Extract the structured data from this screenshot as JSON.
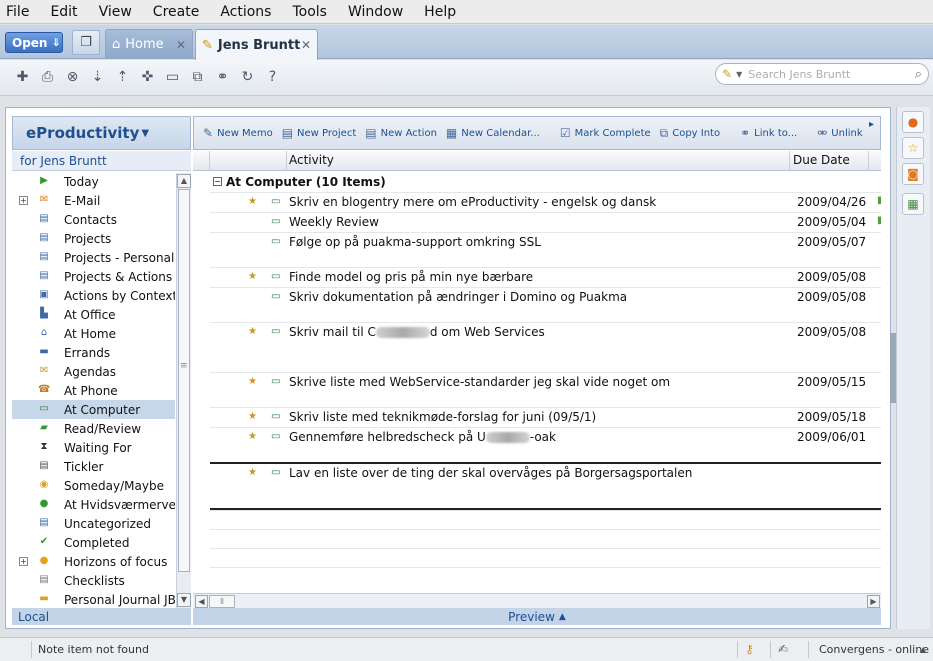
{
  "menu": [
    "File",
    "Edit",
    "View",
    "Create",
    "Actions",
    "Tools",
    "Window",
    "Help"
  ],
  "tabbar": {
    "open_label": "Open",
    "tabs": [
      {
        "label": "Home",
        "icon": "home-icon"
      },
      {
        "label": "Jens Bruntt",
        "icon": "person-icon"
      }
    ]
  },
  "search": {
    "placeholder": "Search Jens Bruntt"
  },
  "nav": {
    "title": "eProductivity",
    "subtitle": "for Jens Bruntt",
    "items": [
      {
        "label": "Today",
        "icon": "flag-icon"
      },
      {
        "label": "E-Mail",
        "icon": "mail-icon",
        "expandable": true
      },
      {
        "label": "Contacts",
        "icon": "contacts-icon"
      },
      {
        "label": "Projects",
        "icon": "projects-icon"
      },
      {
        "label": "Projects - Personal",
        "icon": "projects-icon"
      },
      {
        "label": "Projects & Actions",
        "icon": "projects-icon"
      },
      {
        "label": "Actions by Context",
        "icon": "context-icon"
      },
      {
        "label": "At Office",
        "icon": "office-icon"
      },
      {
        "label": "At Home",
        "icon": "home-icon"
      },
      {
        "label": "Errands",
        "icon": "car-icon"
      },
      {
        "label": "Agendas",
        "icon": "agenda-icon"
      },
      {
        "label": "At Phone",
        "icon": "phone-icon"
      },
      {
        "label": "At Computer",
        "icon": "computer-icon",
        "selected": true
      },
      {
        "label": "Read/Review",
        "icon": "read-icon"
      },
      {
        "label": "Waiting For",
        "icon": "hourglass-icon"
      },
      {
        "label": "Tickler",
        "icon": "tickler-icon"
      },
      {
        "label": "Someday/Maybe",
        "icon": "lightbulb-icon"
      },
      {
        "label": "At Hvidsværmervej",
        "icon": "location-icon"
      },
      {
        "label": "Uncategorized",
        "icon": "uncategorized-icon"
      },
      {
        "label": "Completed",
        "icon": "check-icon"
      },
      {
        "label": "Horizons of focus",
        "icon": "horizon-icon",
        "expandable": true
      },
      {
        "label": "Checklists",
        "icon": "checklist-icon"
      },
      {
        "label": "Personal Journal JB",
        "icon": "journal-icon"
      }
    ],
    "footer": "Local"
  },
  "actions": [
    {
      "label": "New Memo",
      "icon": "new-memo-icon"
    },
    {
      "label": "New Project",
      "icon": "new-project-icon"
    },
    {
      "label": "New Action",
      "icon": "new-action-icon"
    },
    {
      "label": "New Calendar...",
      "icon": "new-calendar-icon"
    },
    {
      "label": "Mark Complete",
      "icon": "mark-complete-icon"
    },
    {
      "label": "Copy Into",
      "icon": "copy-into-icon"
    },
    {
      "label": "Link to...",
      "icon": "link-icon"
    },
    {
      "label": "Unlink",
      "icon": "unlink-icon"
    }
  ],
  "columns": {
    "activity": "Activity",
    "due": "Due Date"
  },
  "group": {
    "label": "At Computer (10 Items)"
  },
  "rows": [
    {
      "star": true,
      "text": "Skriv en blogentry mere om eProductivity - engelsk og dansk",
      "due": "2009/04/26",
      "flag": true
    },
    {
      "star": false,
      "text": "Weekly Review",
      "due": "2009/05/04",
      "flag": true
    },
    {
      "star": false,
      "text": "Følge op på puakma-support omkring SSL",
      "due": "2009/05/07",
      "flag": false
    },
    {
      "star": true,
      "text": "Finde model og pris på min nye bærbare",
      "due": "2009/05/08",
      "flag": false
    },
    {
      "star": false,
      "text": "Skriv dokumentation på ændringer i Domino og Puakma",
      "due": "2009/05/08",
      "flag": false
    },
    {
      "star": true,
      "text_pre": "Skriv mail til C",
      "text_post": "d om Web Services",
      "due": "2009/05/08",
      "flag": false
    },
    {
      "star": true,
      "text": "Skrive liste med WebService-standarder jeg skal vide noget om",
      "due": "2009/05/15",
      "flag": false
    },
    {
      "star": true,
      "text": "Skriv liste med teknikmøde-forslag for juni (09/5/1)",
      "due": "2009/05/18",
      "flag": false
    },
    {
      "star": true,
      "text_pre": "Gennemføre helbredscheck på U",
      "text_post": "-oak",
      "due": "2009/06/01",
      "flag": false
    },
    {
      "star": true,
      "text": "Lav en liste over de ting der skal overvåges på Borgersagsportalen",
      "due": "",
      "flag": false
    }
  ],
  "preview_label": "Preview",
  "status": {
    "message": "Note item not found",
    "online": "Convergens - online"
  }
}
